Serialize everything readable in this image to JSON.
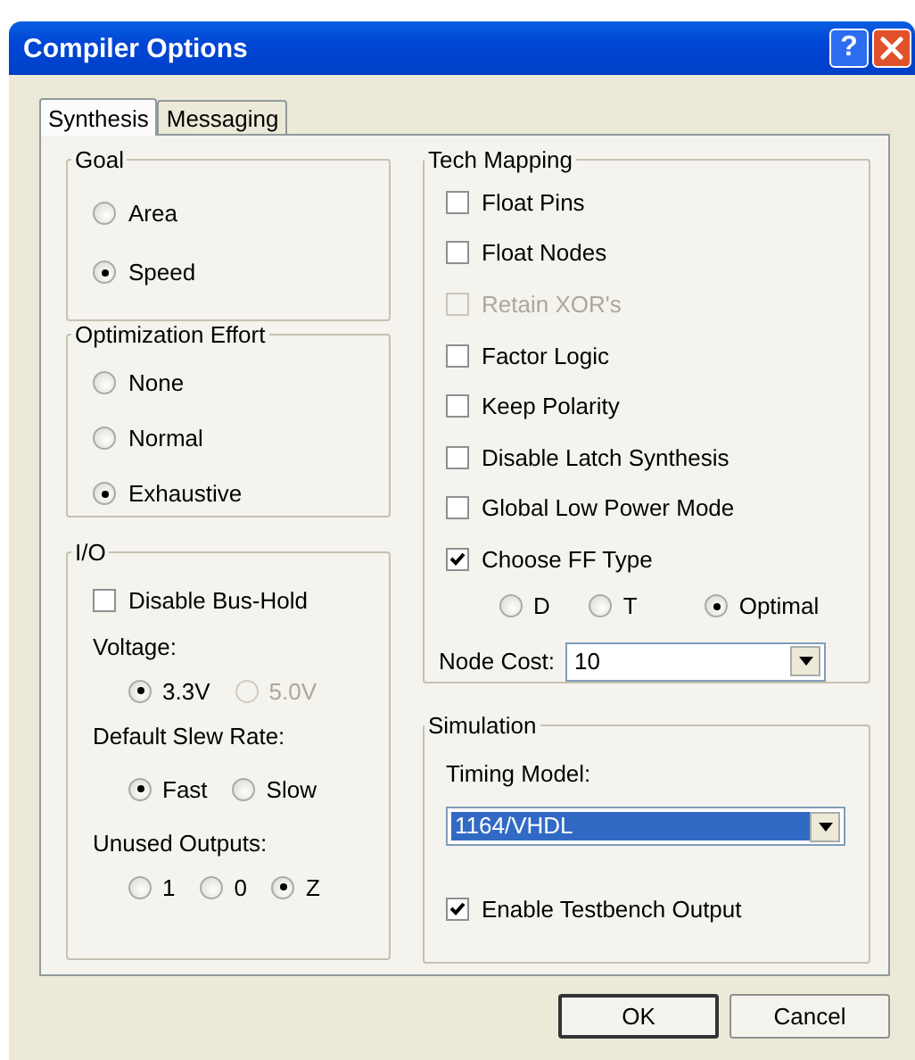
{
  "window": {
    "title": "Compiler Options",
    "help_label": "?"
  },
  "tabs": [
    {
      "label": "Synthesis",
      "selected": true
    },
    {
      "label": "Messaging",
      "selected": false
    }
  ],
  "goal": {
    "title": "Goal",
    "options": [
      {
        "label": "Area",
        "selected": false
      },
      {
        "label": "Speed",
        "selected": true
      }
    ]
  },
  "optimization_effort": {
    "title": "Optimization Effort",
    "options": [
      {
        "label": "None",
        "selected": false
      },
      {
        "label": "Normal",
        "selected": false
      },
      {
        "label": "Exhaustive",
        "selected": true
      }
    ]
  },
  "io": {
    "title": "I/O",
    "disable_bus_hold": {
      "label": "Disable Bus-Hold",
      "checked": false
    },
    "voltage": {
      "label": "Voltage:",
      "options": [
        {
          "label": "3.3V",
          "selected": true,
          "disabled": false
        },
        {
          "label": "5.0V",
          "selected": false,
          "disabled": true
        }
      ]
    },
    "slew_rate": {
      "label": "Default Slew Rate:",
      "options": [
        {
          "label": "Fast",
          "selected": true
        },
        {
          "label": "Slow",
          "selected": false
        }
      ]
    },
    "unused_outputs": {
      "label": "Unused Outputs:",
      "options": [
        {
          "label": "1",
          "selected": false
        },
        {
          "label": "0",
          "selected": false
        },
        {
          "label": "Z",
          "selected": true
        }
      ]
    }
  },
  "tech_mapping": {
    "title": "Tech Mapping",
    "checkboxes": [
      {
        "label": "Float Pins",
        "checked": false,
        "disabled": false
      },
      {
        "label": "Float Nodes",
        "checked": false,
        "disabled": false
      },
      {
        "label": "Retain XOR's",
        "checked": false,
        "disabled": true
      },
      {
        "label": "Factor Logic",
        "checked": false,
        "disabled": false
      },
      {
        "label": "Keep Polarity",
        "checked": false,
        "disabled": false
      },
      {
        "label": "Disable Latch Synthesis",
        "checked": false,
        "disabled": false
      },
      {
        "label": "Global Low Power Mode",
        "checked": false,
        "disabled": false
      },
      {
        "label": "Choose FF Type",
        "checked": true,
        "disabled": false
      }
    ],
    "ff_types": [
      {
        "label": "D",
        "selected": false
      },
      {
        "label": "T",
        "selected": false
      },
      {
        "label": "Optimal",
        "selected": true
      }
    ],
    "node_cost": {
      "label": "Node Cost:",
      "value": "10"
    }
  },
  "simulation": {
    "title": "Simulation",
    "timing_model": {
      "label": "Timing Model:",
      "value": "1164/VHDL"
    },
    "testbench": {
      "label": "Enable Testbench Output",
      "checked": true
    }
  },
  "buttons": [
    {
      "label": "OK",
      "default": true
    },
    {
      "label": "Cancel",
      "default": false
    }
  ]
}
